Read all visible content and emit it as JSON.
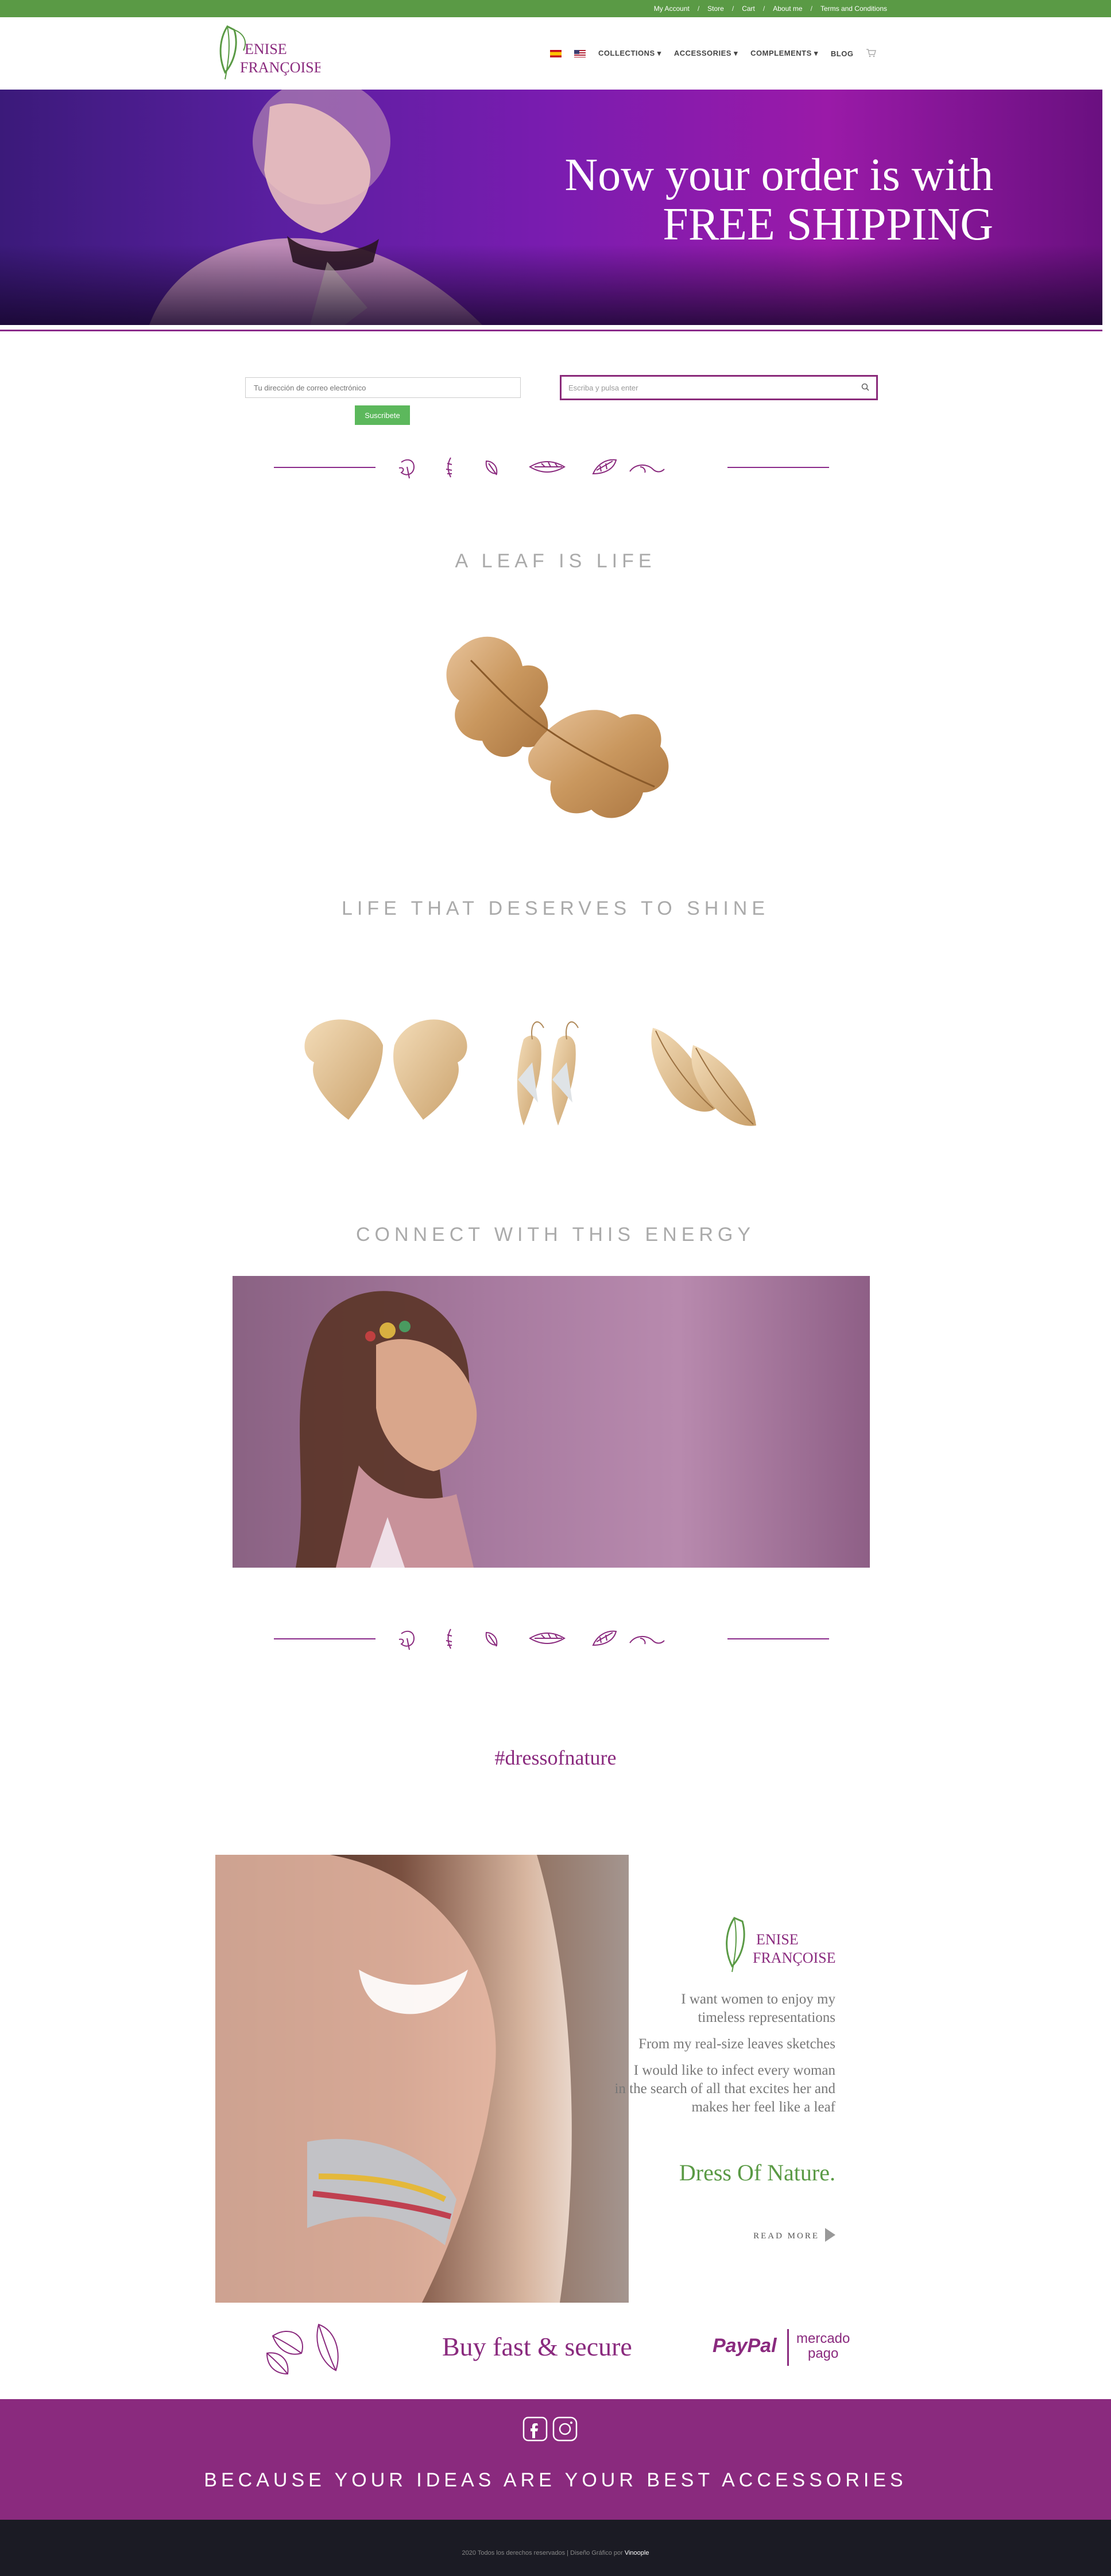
{
  "topbar": {
    "links": [
      "My Account",
      "Store",
      "Cart",
      "About me",
      "Terms and Conditions"
    ],
    "separator": "/"
  },
  "header": {
    "logo_line1": "ENISE",
    "logo_line2": "FRANÇOISE",
    "logo_initial": "D",
    "nav": [
      "COLLECTIONS",
      "ACCESSORIES",
      "COMPLEMENTS",
      "BLOG"
    ],
    "chevron": "▾"
  },
  "hero": {
    "line1": "Now your order is with",
    "line2": "FREE SHIPPING"
  },
  "newsletter": {
    "placeholder": "Tu dirección de correo electrónico",
    "button": "Suscribete"
  },
  "search": {
    "placeholder": "Escriba y pulsa enter"
  },
  "sections": {
    "leaf_title": "A LEAF IS LIFE",
    "shine_title": "LIFE THAT DESERVES TO SHINE",
    "energy_title": "CONNECT WITH THIS ENERGY",
    "hashtag": "#dressofnature"
  },
  "promo": {
    "text1a": "I want women to enjoy my",
    "text1b": "timeless representations",
    "text2": "From my real-size leaves sketches",
    "text3a": "I would like to infect every woman",
    "text3b": "in the search of all that excites her and",
    "text3c": "makes her feel like a leaf",
    "headline": "Dress Of Nature.",
    "read_more": "READ MORE"
  },
  "payment": {
    "headline": "Buy fast & secure",
    "paypal": "PayPal",
    "mercado1": "mercado",
    "mercado2": "pago"
  },
  "footer": {
    "tagline": "BECAUSE YOUR IDEAS ARE YOUR BEST ACCESSORIES",
    "copyright": "2020 Todos los derechos reservados | Diseño Gráfico por",
    "studio": "Vinoople"
  },
  "icons": {
    "facebook": "facebook-icon",
    "instagram": "instagram-icon",
    "cart": "cart-icon",
    "search": "search-icon"
  },
  "colors": {
    "green": "#5a9a45",
    "purple": "#8a2a7e",
    "dark": "#1b1b24"
  }
}
